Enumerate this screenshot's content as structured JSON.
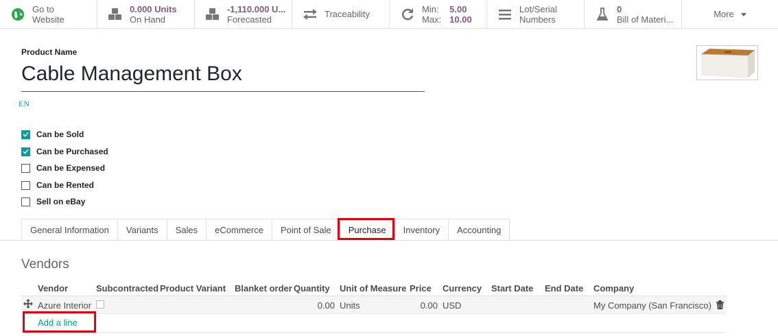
{
  "smart_buttons": {
    "website": {
      "line1": "Go to",
      "line2": "Website"
    },
    "on_hand": {
      "value": "0.000 Units",
      "label": "On Hand"
    },
    "forecasted": {
      "value": "-1,110.000 U...",
      "label": "Forecasted"
    },
    "traceability": {
      "label": "Traceability"
    },
    "minmax": {
      "min_label": "Min:",
      "min_value": "5.00",
      "max_label": "Max:",
      "max_value": "10.00"
    },
    "lot_serial": {
      "line1": "Lot/Serial",
      "line2": "Numbers"
    },
    "bom": {
      "value": "0",
      "label": "Bill of Materi..."
    },
    "more": {
      "label": "More"
    }
  },
  "product": {
    "name_label": "Product Name",
    "name": "Cable Management Box",
    "lang": "EN"
  },
  "options": [
    {
      "label": "Can be Sold",
      "checked": true
    },
    {
      "label": "Can be Purchased",
      "checked": true
    },
    {
      "label": "Can be Expensed",
      "checked": false
    },
    {
      "label": "Can be Rented",
      "checked": false
    },
    {
      "label": "Sell on eBay",
      "checked": false
    }
  ],
  "tabs": [
    "General Information",
    "Variants",
    "Sales",
    "eCommerce",
    "Point of Sale",
    "Purchase",
    "Inventory",
    "Accounting"
  ],
  "active_tab": "Purchase",
  "vendors": {
    "title": "Vendors",
    "columns": [
      "Vendor",
      "Subcontracted",
      "Product Variant",
      "Blanket order",
      "Quantity",
      "Unit of Measure",
      "Price",
      "Currency",
      "Start Date",
      "End Date",
      "Company"
    ],
    "rows": [
      {
        "vendor": "Azure Interior",
        "subcontracted": false,
        "product_variant": "",
        "blanket_order": "",
        "quantity": "0.00",
        "uom": "Units",
        "price": "0.00",
        "currency": "USD",
        "start_date": "",
        "end_date": "",
        "company": "My Company (San Francisco)"
      }
    ],
    "add_line": "Add a line"
  },
  "colors": {
    "accent": "#00a09d",
    "smart_value": "#875a7b",
    "highlight": "#e3000f"
  }
}
